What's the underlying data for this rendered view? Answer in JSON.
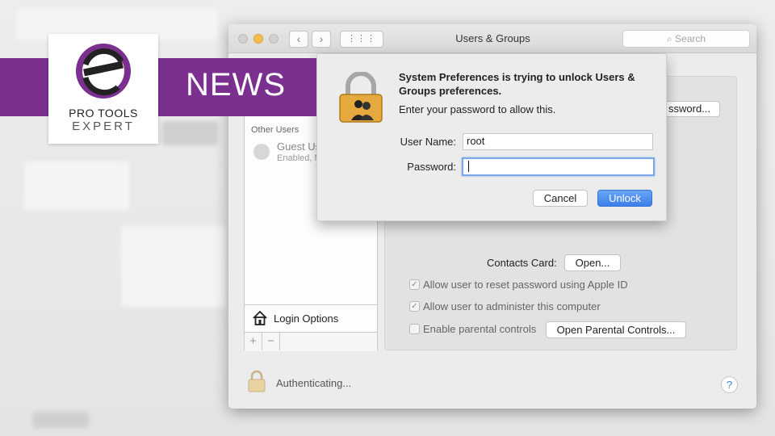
{
  "window": {
    "title": "Users & Groups",
    "search_placeholder": "Search",
    "nav_back": "‹",
    "nav_forward": "›",
    "grid_glyph": "⋮⋮⋮"
  },
  "sidebar": {
    "section_label": "Other Users",
    "guest_name": "Guest Us",
    "guest_status": "Enabled, N",
    "login_options_label": "Login Options",
    "add_label": "+",
    "remove_label": "−"
  },
  "main": {
    "password_button_label": "ssword...",
    "contacts_card_label": "Contacts Card:",
    "open_button_label": "Open...",
    "checks": [
      {
        "label": "Allow user to reset password using Apple ID",
        "checked": true
      },
      {
        "label": "Allow user to administer this computer",
        "checked": true
      },
      {
        "label": "Enable parental controls",
        "checked": false
      }
    ],
    "parental_button_label": "Open Parental Controls...",
    "auth_status": "Authenticating...",
    "help_label": "?"
  },
  "dialog": {
    "title": "System Preferences is trying to unlock Users & Groups preferences.",
    "message": "Enter your password to allow this.",
    "username_label": "User Name:",
    "username_value": "root",
    "password_label": "Password:",
    "password_value": "",
    "cancel_label": "Cancel",
    "unlock_label": "Unlock"
  },
  "overlay": {
    "banner_text": "NEWS",
    "logo_line1": "PRO TOOLS",
    "logo_line2": "EXPERT",
    "banner_color": "#7b2f8f",
    "accent_blue": "#3b7ee8"
  }
}
